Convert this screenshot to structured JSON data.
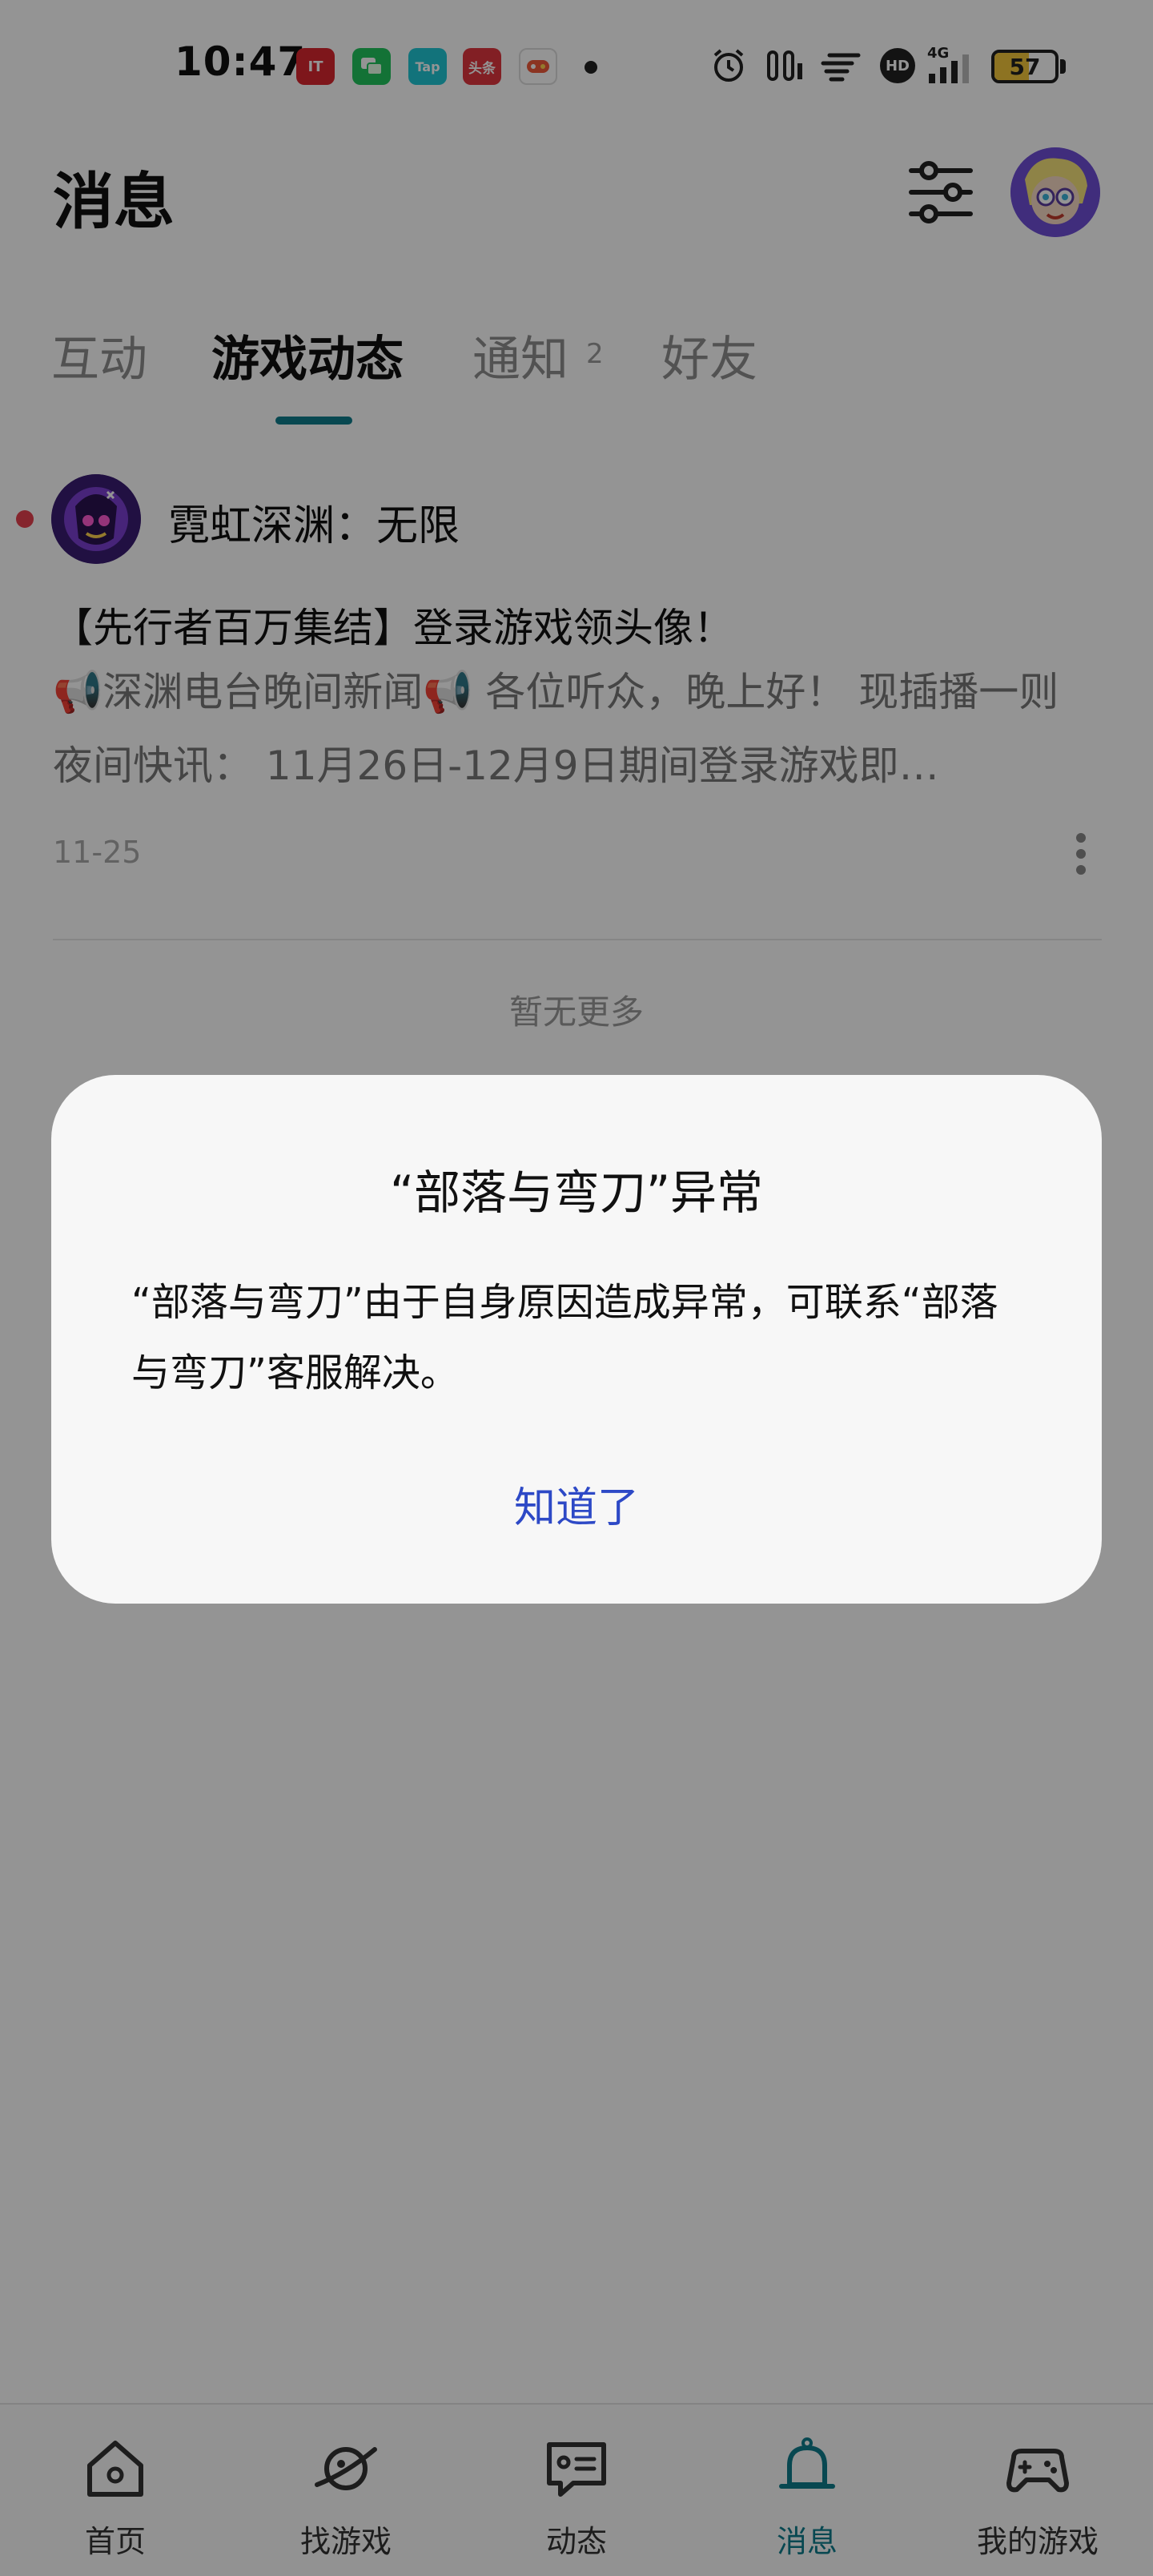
{
  "status_bar": {
    "time": "10:47",
    "notification_icons": [
      {
        "name": "it-app-icon",
        "label": "IT",
        "color": "#d9272f"
      },
      {
        "name": "wechat-icon",
        "label": "",
        "color": "#22c55e"
      },
      {
        "name": "taptap-icon",
        "label": "Tap",
        "color": "#1fc6d4"
      },
      {
        "name": "toutiao-icon",
        "label": "头条",
        "color": "#e0363f"
      },
      {
        "name": "game-icon",
        "label": "",
        "color": "#ef5a3b"
      }
    ],
    "network": "4G",
    "hd_label": "HD",
    "battery": "57",
    "battery_level": 0.57
  },
  "header": {
    "title": "消息"
  },
  "tabs": [
    {
      "label": "互动",
      "active": false
    },
    {
      "label": "游戏动态",
      "active": true
    },
    {
      "label": "通知",
      "active": false,
      "badge": "2"
    },
    {
      "label": "好友",
      "active": false
    }
  ],
  "message": {
    "sender": "霓虹深渊：无限",
    "title": "【先行者百万集结】登录游戏领头像！",
    "body": "📢深渊电台晚间新闻📢 各位听众，晚上好！ 现插播一则夜间快讯： 11月26日-12月9日期间登录游戏即…",
    "date": "11-25",
    "unread": true
  },
  "list_footer": "暂无更多",
  "dialog": {
    "title": "“部落与弯刀”异常",
    "text": "“部落与弯刀”由于自身原因造成异常，可联系“部落与弯刀”客服解决。",
    "confirm_label": "知道了"
  },
  "bottom_nav": [
    {
      "label": "首页",
      "icon": "home-icon",
      "active": false
    },
    {
      "label": "找游戏",
      "icon": "planet-icon",
      "active": false
    },
    {
      "label": "动态",
      "icon": "chat-bubble-icon",
      "active": false
    },
    {
      "label": "消息",
      "icon": "bell-icon",
      "active": true
    },
    {
      "label": "我的游戏",
      "icon": "gamepad-icon",
      "active": false
    }
  ],
  "colors": {
    "accent": "#0f7c8c",
    "dialog_button": "#2d49c6",
    "unread_dot": "#e5414e"
  }
}
